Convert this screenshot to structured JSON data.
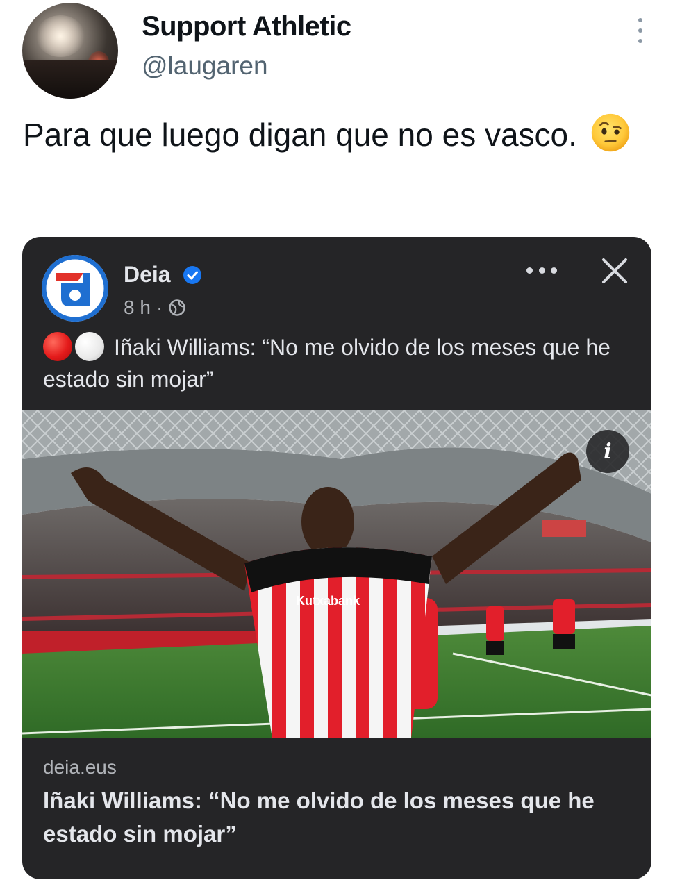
{
  "tweet": {
    "display_name": "Support Athletic",
    "handle": "@laugaren",
    "text": "Para que luego digan que no es vasco.",
    "emoji": "face-with-raised-eyebrow"
  },
  "embedded_post": {
    "page_name": "Deia",
    "verified": true,
    "time": "8 h",
    "separator": "·",
    "audience": "globe-icon",
    "text": "Iñaki Williams: “No me olvido de los meses que he estado sin mojar”",
    "image_alt": "Stadium celebration photo",
    "jersey_sponsor": "Kutxabank",
    "link": {
      "domain": "deia.eus",
      "title": "Iñaki Williams: “No me olvido de los meses que he estado sin mojar”"
    }
  },
  "colors": {
    "card_bg": "#252527",
    "verified_blue": "#1877f2",
    "text_dark": "#0f1419",
    "handle_gray": "#536471"
  }
}
